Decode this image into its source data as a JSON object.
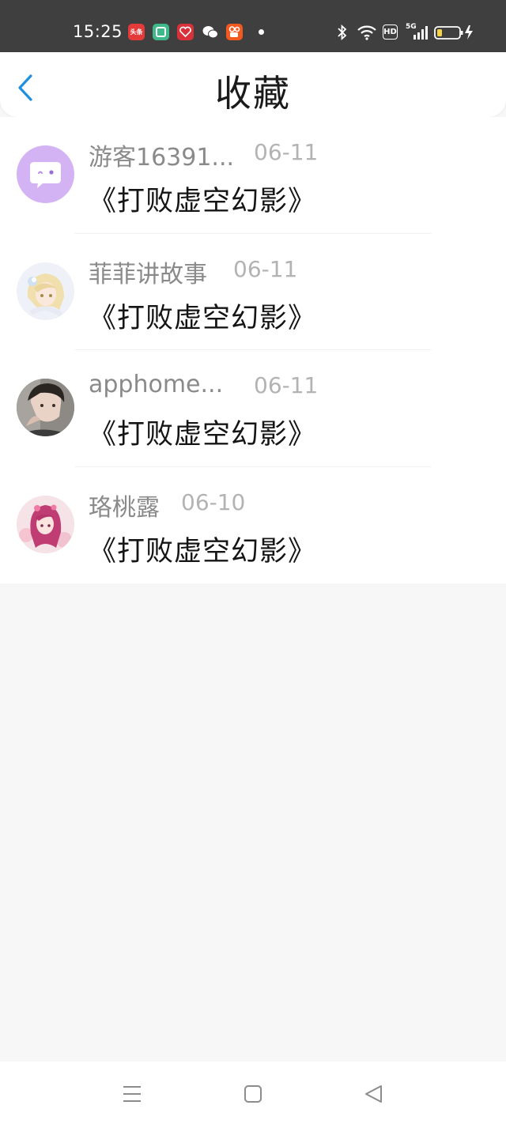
{
  "status_bar": {
    "time": "15:25",
    "app_icons": [
      {
        "name": "toutiao-icon",
        "label": "头条",
        "color": "#e43a3a"
      },
      {
        "name": "notes-icon",
        "label": "",
        "color": "#40b98a"
      },
      {
        "name": "heart-app-icon",
        "label": "",
        "color": "#d8313a"
      },
      {
        "name": "wechat-icon",
        "label": "",
        "color": "#ffffff"
      },
      {
        "name": "kuaishou-icon",
        "label": "",
        "color": "#f2591e"
      }
    ],
    "hd_label": "HD",
    "network_label": "5G"
  },
  "header": {
    "title": "收藏",
    "back_icon": "chevron-left-icon",
    "accent_color": "#1f8fe0"
  },
  "favorites": [
    {
      "username": "游客16391...",
      "date": "06-11",
      "title": "《打败虚空幻影》",
      "avatar": "chat-bubble-avatar"
    },
    {
      "username": "菲菲讲故事",
      "date": "06-11",
      "title": "《打败虚空幻影》",
      "avatar": "anime-girl-avatar"
    },
    {
      "username": "apphome...",
      "date": "06-11",
      "title": "《打败虚空幻影》",
      "avatar": "photo-avatar"
    },
    {
      "username": "珞桃露",
      "date": "06-10",
      "title": "《打败虚空幻影》",
      "avatar": "anime-pink-avatar"
    }
  ],
  "nav_bar": {
    "menu_icon": "menu-icon",
    "home_icon": "home-square-icon",
    "back_icon": "back-triangle-icon"
  }
}
